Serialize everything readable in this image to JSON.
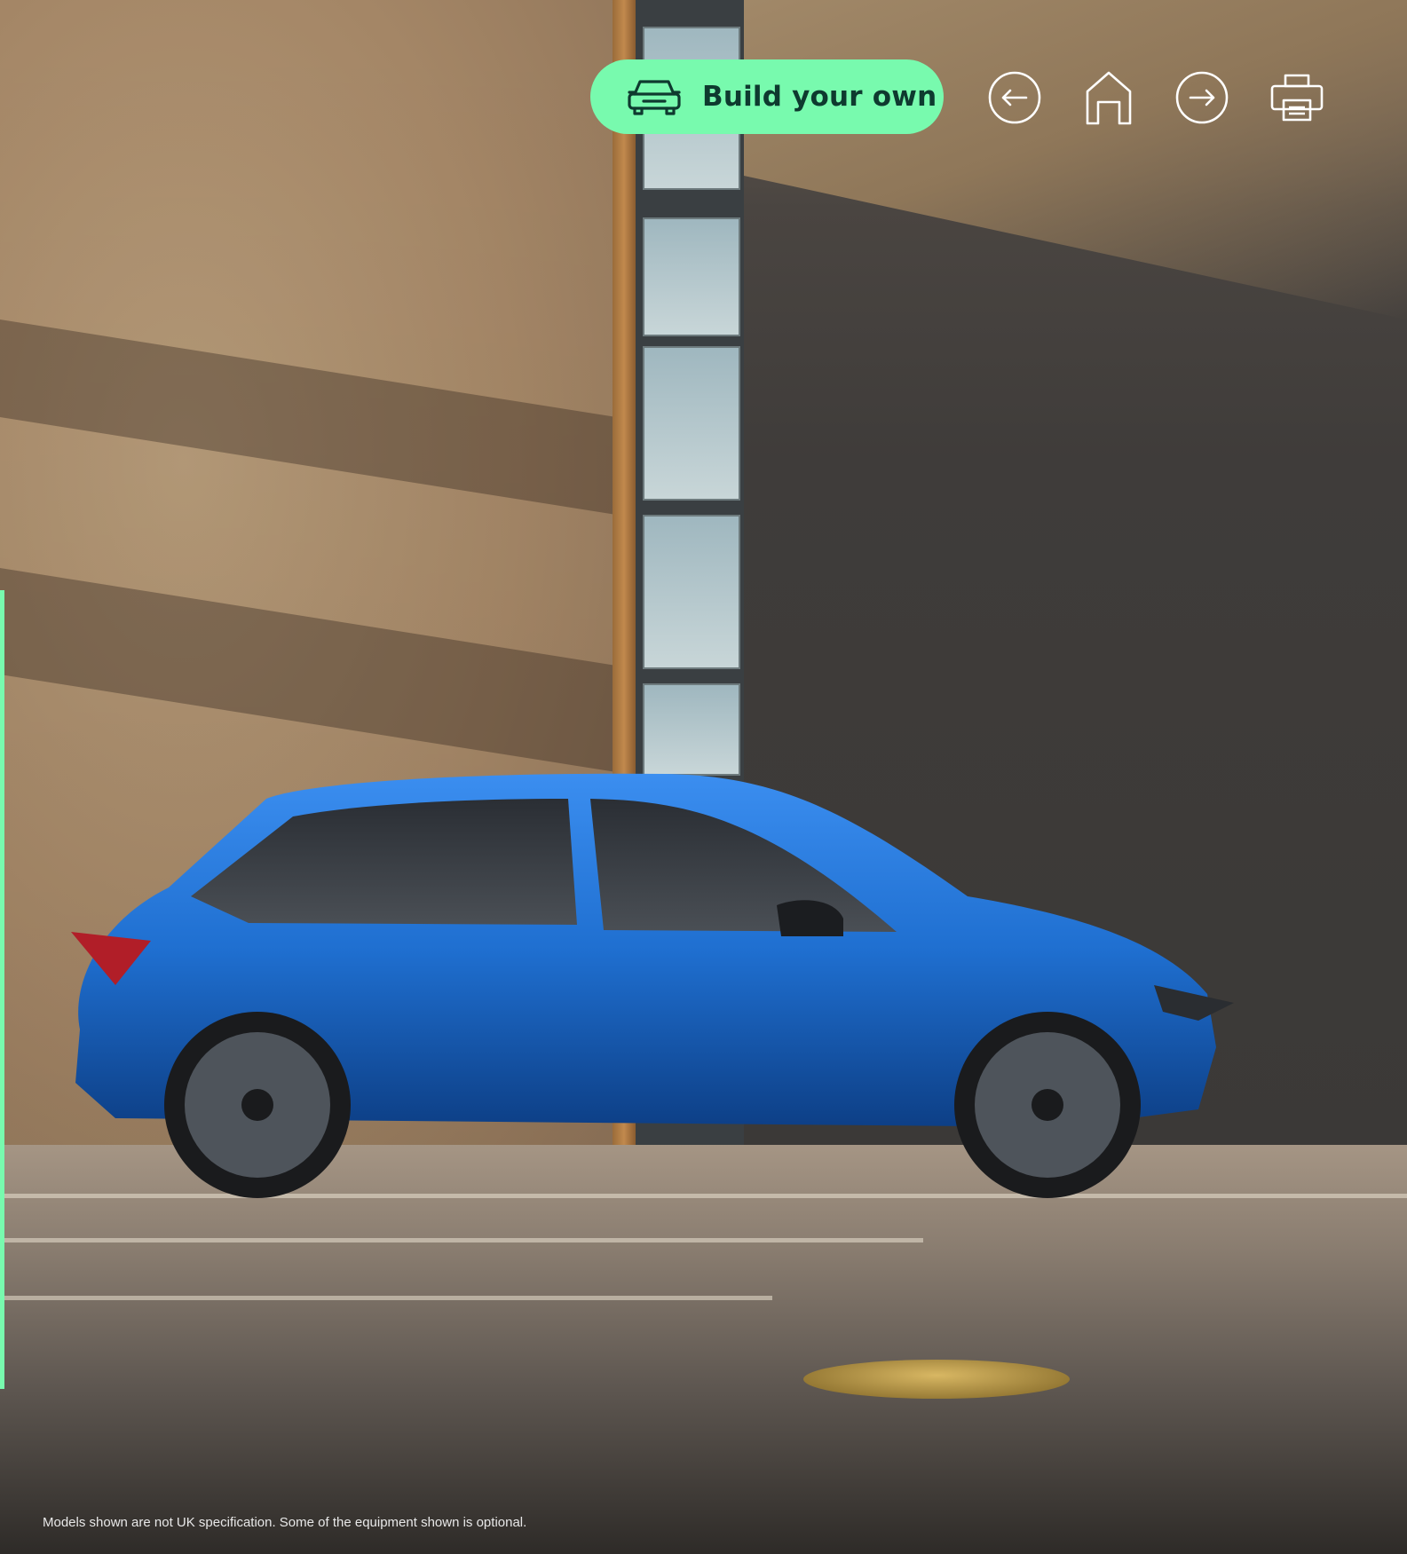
{
  "toolbar": {
    "build_label": "Build your own",
    "icons": {
      "build": "car-front-icon",
      "back": "arrow-left-circle-icon",
      "home": "home-icon",
      "forward": "arrow-right-circle-icon",
      "print": "printer-icon"
    }
  },
  "footer": {
    "disclaimer": "Models shown are not UK specification. Some of the equipment shown is optional."
  },
  "colors": {
    "accent": "#78faae",
    "accent_text": "#0e3a2f",
    "icon_stroke": "#ffffff",
    "car_body": "#1f6fd0"
  }
}
